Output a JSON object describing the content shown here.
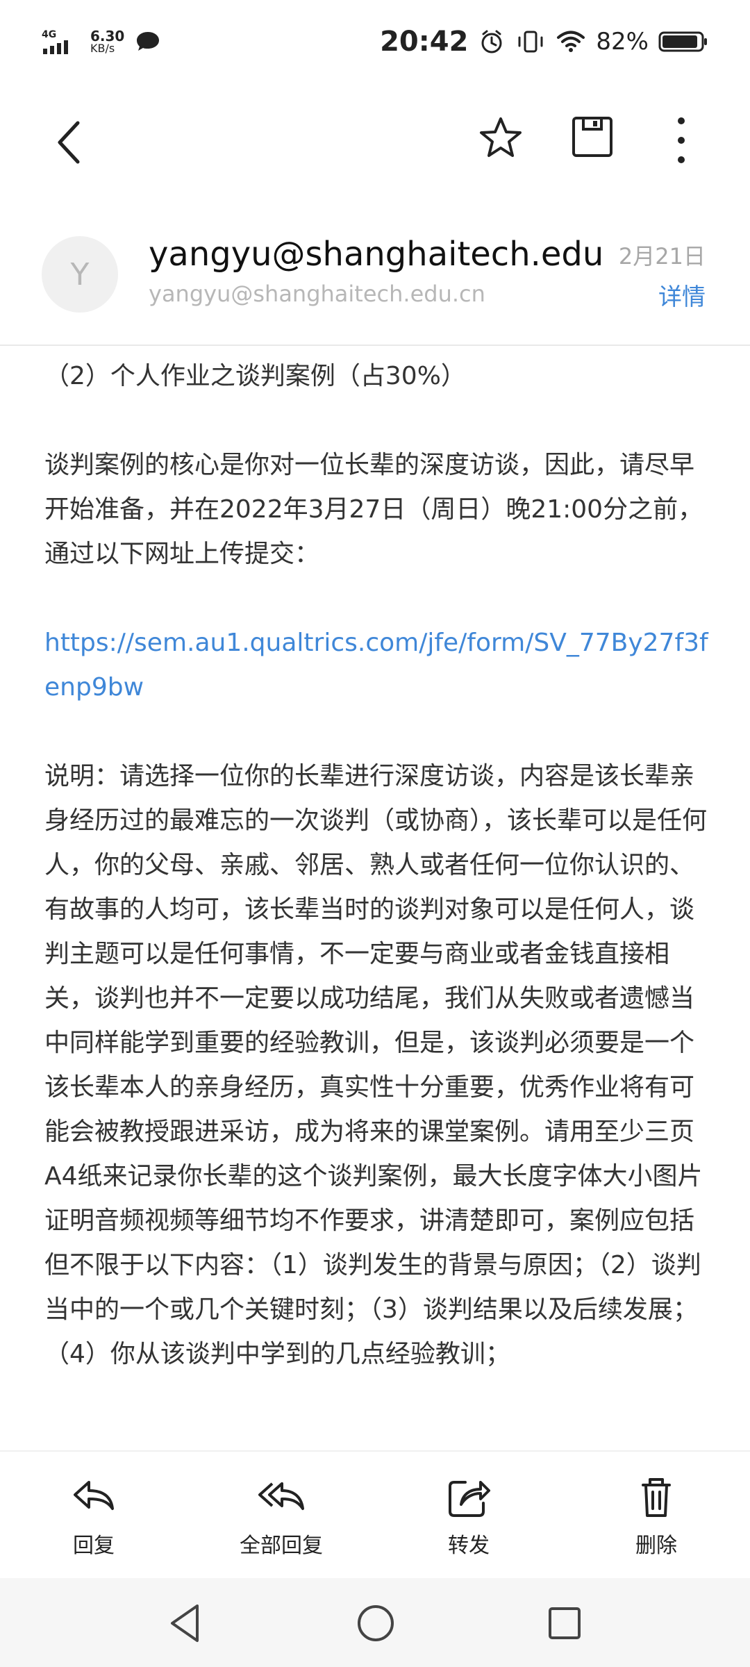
{
  "status_bar": {
    "network": "4G",
    "speed_value": "6.30",
    "speed_unit": "KB/s",
    "time": "20:42",
    "battery": "82%"
  },
  "email": {
    "avatar_letter": "Y",
    "sender_name": "yangyu@shanghaitech.edu",
    "sender_email": "yangyu@shanghaitech.edu.cn",
    "date": "2月21日",
    "details_label": "详情",
    "body": {
      "p1": "（2）个人作业之谈判案例（占30%）",
      "p2": "谈判案例的核心是你对一位长辈的深度访谈，因此，请尽早开始准备，并在2022年3月27日（周日）晚21:00分之前，通过以下网址上传提交：",
      "link": "https://sem.au1.qualtrics.com/jfe/form/SV_77By27f3fenp9bw",
      "p3": "说明：请选择一位你的长辈进行深度访谈，内容是该长辈亲身经历过的最难忘的一次谈判（或协商），该长辈可以是任何人，你的父母、亲戚、邻居、熟人或者任何一位你认识的、有故事的人均可，该长辈当时的谈判对象可以是任何人，谈判主题可以是任何事情，不一定要与商业或者金钱直接相关，谈判也并不一定要以成功结尾，我们从失败或者遗憾当中同样能学到重要的经验教训，但是，该谈判必须要是一个该长辈本人的亲身经历，真实性十分重要，优秀作业将有可能会被教授跟进采访，成为将来的课堂案例。请用至少三页A4纸来记录你长辈的这个谈判案例，最大长度字体大小图片证明音频视频等细节均不作要求，讲清楚即可，案例应包括但不限于以下内容：（1）谈判发生的背景与原因；（2）谈判当中的一个或几个关键时刻；（3）谈判结果以及后续发展；（4）你从该谈判中学到的几点经验教训；"
    }
  },
  "actions": {
    "reply": "回复",
    "reply_all": "全部回复",
    "forward": "转发",
    "delete": "删除"
  },
  "colors": {
    "link": "#3f87d8",
    "text": "#333333",
    "muted": "#b7b7b7"
  },
  "icons": {
    "back": "chevron-left-icon",
    "star": "star-icon",
    "save": "save-icon",
    "more": "more-vertical-icon",
    "reply": "reply-icon",
    "reply_all": "reply-all-icon",
    "forward": "forward-icon",
    "delete": "trash-icon"
  }
}
